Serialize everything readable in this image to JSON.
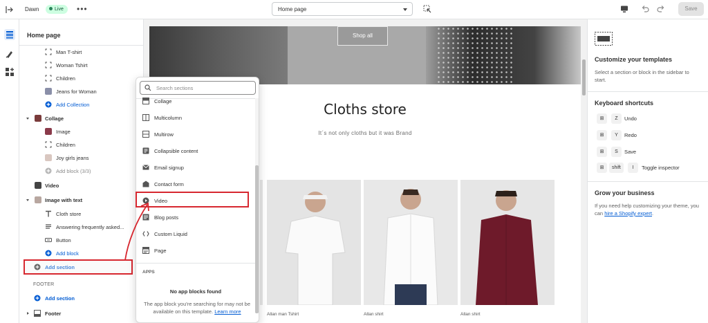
{
  "topbar": {
    "theme_name": "Dawn",
    "status_badge": "Live",
    "more_label": "•••",
    "page_select_value": "Home page",
    "save_label": "Save"
  },
  "sidebar": {
    "title": "Home page",
    "rows": {
      "man_tshirt": "Man T-shirt",
      "woman_tshirt": "Woman Tshirt",
      "children": "Children",
      "jeans_for_woman": "Jeans for Woman",
      "add_collection": "Add Collection",
      "collage": "Collage",
      "image": "Image",
      "children2": "Children",
      "joy_girls_jeans": "Joy girls jeans",
      "add_block_limit": "Add block (3/3)",
      "video": "Video",
      "image_with_text": "Image with text",
      "cloth_store": "Cloth store",
      "answering": "Answering frequently asked...",
      "button": "Button",
      "add_block": "Add block",
      "add_section": "Add section",
      "footer_heading": "FOOTER",
      "footer_add_section": "Add section",
      "footer": "Footer"
    }
  },
  "popup": {
    "search_placeholder": "Search sections",
    "items": [
      "Collage",
      "Multicolumn",
      "Multirow",
      "Collapsible content",
      "Email signup",
      "Contact form",
      "Video",
      "Blog posts",
      "Custom Liquid",
      "Page"
    ],
    "apps_heading": "APPS",
    "no_app_blocks_title": "No app blocks found",
    "no_app_blocks_desc": "The app block you're searching for may not be available on this template.",
    "learn_more": "Learn more"
  },
  "preview": {
    "shop_all": "Shop all",
    "store_title": "Cloths store",
    "store_subtitle": "It´s not only cloths but it was Brand",
    "products": [
      "Allan man Tshirt",
      "Allan shirt",
      "Allan shirt"
    ]
  },
  "right_panel": {
    "customize_title": "Customize your templates",
    "customize_desc": "Select a section or block in the sidebar to start.",
    "shortcuts_title": "Keyboard shortcuts",
    "shortcuts": [
      {
        "mod": "⊞",
        "key": "Z",
        "action": "Undo"
      },
      {
        "mod": "⊞",
        "key": "Y",
        "action": "Redo"
      },
      {
        "mod": "⊞",
        "key": "S",
        "action": "Save"
      },
      {
        "mod": "⊞",
        "key2": "shift",
        "key": "I",
        "action": "Toggle inspector"
      }
    ],
    "grow_title": "Grow your business",
    "grow_desc": "If you need help customizing your theme, you can",
    "grow_link": "hire a Shopify expert",
    "grow_end": "."
  },
  "colors": {
    "accent_blue": "#005bd3",
    "highlight_red": "#d7272f",
    "live_badge_bg": "#cdfee1"
  }
}
